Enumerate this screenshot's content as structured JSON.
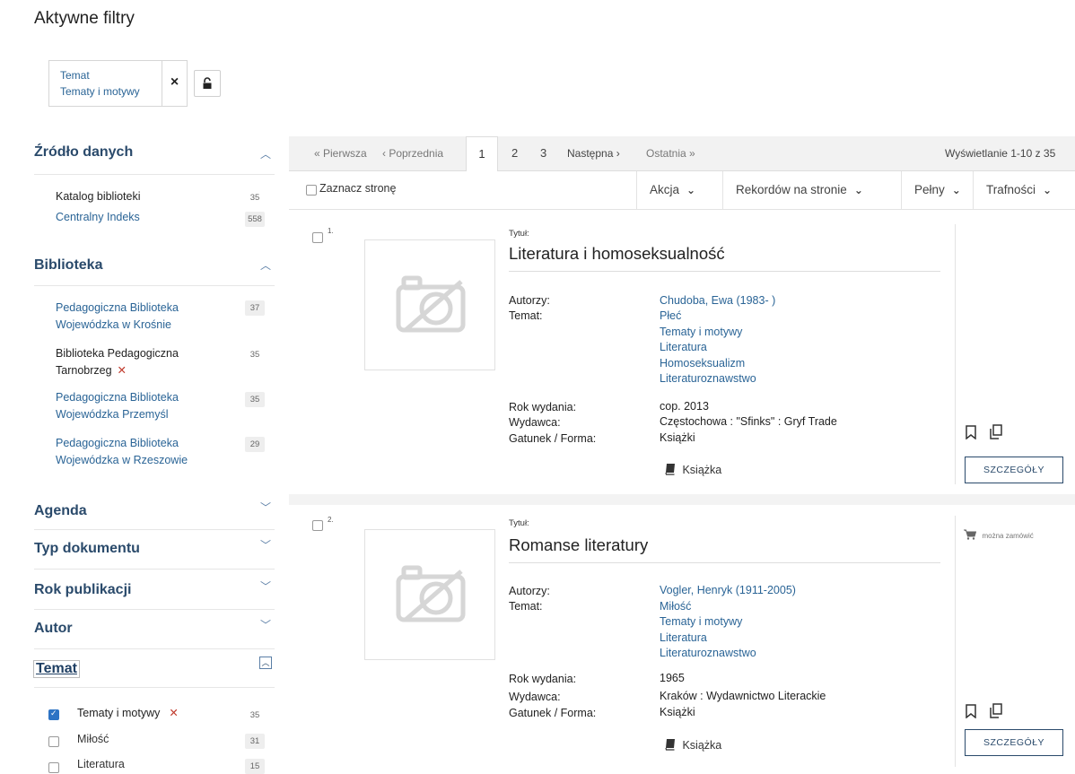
{
  "active_filters": {
    "title": "Aktywne filtry",
    "chip": {
      "line1": "Temat",
      "line2": "Tematy i motywy",
      "remove": "×"
    }
  },
  "sidebar": {
    "zrodlo": {
      "title": "Źródło danych",
      "items": [
        {
          "label": "Katalog biblioteki",
          "count": "35"
        },
        {
          "label": "Centralny Indeks",
          "count": "558"
        }
      ]
    },
    "biblioteka": {
      "title": "Biblioteka",
      "items": [
        {
          "l1": "Pedagogiczna Biblioteka",
          "l2": "Wojewódzka w Krośnie",
          "count": "37"
        },
        {
          "l1": "Biblioteka Pedagogiczna",
          "l2": "Tarnobrzeg",
          "count": "35",
          "remove": "✕"
        },
        {
          "l1": "Pedagogiczna Biblioteka",
          "l2": "Wojewódzka Przemyśl",
          "count": "35"
        },
        {
          "l1": "Pedagogiczna Biblioteka",
          "l2": "Wojewódzka w Rzeszowie",
          "count": "29"
        }
      ]
    },
    "collapsed": [
      "Agenda",
      "Typ dokumentu",
      "Rok publikacji",
      "Autor"
    ],
    "temat": {
      "title": "Temat",
      "items": [
        {
          "label": "Tematy i motywy",
          "count": "35",
          "remove": "✕"
        },
        {
          "label": "Miłość",
          "count": "31"
        },
        {
          "label": "Literatura",
          "count": "15"
        }
      ]
    }
  },
  "pagination": {
    "first": "« Pierwsza",
    "prev": "‹ Poprzednia",
    "current": "1",
    "p2": "2",
    "p3": "3",
    "next": "Następna ›",
    "last": "Ostatnia »",
    "showing": "Wyświetlanie 1-10 z 35"
  },
  "toolbar": {
    "select_page": "Zaznacz stronę",
    "action": "Akcja",
    "per_page": "Rekordów na stronie",
    "view": "Pełny",
    "sort": "Trafności"
  },
  "labels": {
    "title": "Tytuł:",
    "authors": "Autorzy:",
    "subject": "Temat:",
    "year": "Rok wydania:",
    "publisher": "Wydawca:",
    "genre": "Gatunek / Forma:",
    "details": "SZCZEGÓŁY"
  },
  "records": [
    {
      "num": "1.",
      "title": "Literatura i homoseksualność",
      "author": "Chudoba, Ewa (1983- )",
      "subjects": [
        "Płeć",
        "Tematy i motywy",
        "Literatura",
        "Homoseksualizm",
        "Literaturoznawstwo"
      ],
      "year": "cop. 2013",
      "publisher": "Częstochowa : \"Sfinks\" : Gryf Trade",
      "genre": "Książki",
      "format": "Książka"
    },
    {
      "num": "2.",
      "title": "Romanse literatury",
      "author": "Vogler, Henryk (1911-2005)",
      "subjects": [
        "Miłość",
        "Tematy i motywy",
        "Literatura",
        "Literaturoznawstwo"
      ],
      "year": "1965",
      "publisher": "Kraków : Wydawnictwo Literackie",
      "genre": "Książki",
      "format": "Książka",
      "order": "można zamówić"
    }
  ]
}
